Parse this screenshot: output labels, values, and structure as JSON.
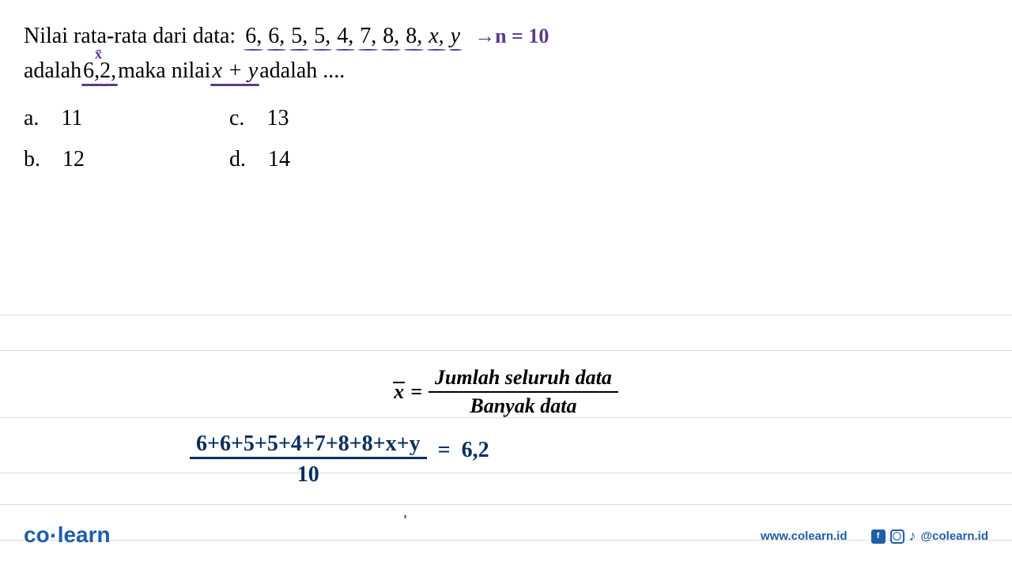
{
  "question": {
    "prefix1": "Nilai rata-rata dari data:",
    "data_items": [
      "6,",
      "6,",
      "5,",
      "5,",
      "4,",
      "7,",
      "8,",
      "8,",
      "x,",
      "y"
    ],
    "annotation_arrow": "→",
    "annotation_x": "x̄",
    "annotation_n": "n = 10",
    "line2_word1": "adalah",
    "line2_value": "6,2,",
    "line2_mid": "maka nilai",
    "line2_expr": "x + y",
    "line2_end": "adalah ...."
  },
  "options": {
    "a": {
      "letter": "a.",
      "value": "11"
    },
    "b": {
      "letter": "b.",
      "value": "12"
    },
    "c": {
      "letter": "c.",
      "value": "13"
    },
    "d": {
      "letter": "d.",
      "value": "14"
    }
  },
  "formula": {
    "xbar": "x",
    "equals": "=",
    "numerator": "Jumlah seluruh data",
    "denominator": "Banyak data"
  },
  "handwritten": {
    "numerator": "6+6+5+5+4+7+8+8+x+y",
    "denominator": "10",
    "equals": "=",
    "result": "6,2",
    "mark": "'"
  },
  "footer": {
    "logo_co": "co",
    "logo_dot": "·",
    "logo_learn": "learn",
    "url": "www.colearn.id",
    "handle": "@colearn.id"
  }
}
